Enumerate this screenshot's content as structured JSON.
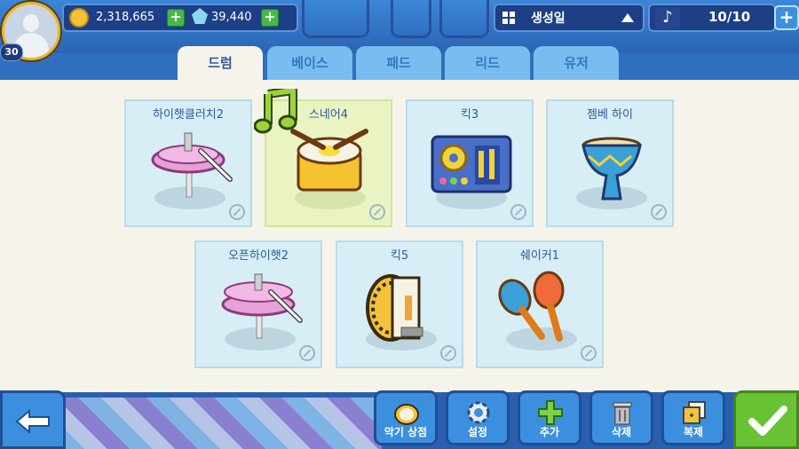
{
  "player": {
    "level": "30"
  },
  "currency": {
    "coins": "2,318,665",
    "gems": "39,440"
  },
  "sort": {
    "label": "생성일"
  },
  "notes": {
    "count": "10/10"
  },
  "tabs": [
    {
      "label": "드럼",
      "active": true
    },
    {
      "label": "베이스",
      "active": false
    },
    {
      "label": "패드",
      "active": false
    },
    {
      "label": "리드",
      "active": false
    },
    {
      "label": "유저",
      "active": false
    }
  ],
  "instruments": [
    {
      "name": "하이햇클러치2",
      "icon": "cymbal-icon",
      "selected": false
    },
    {
      "name": "스네어4",
      "icon": "snare-drum-icon",
      "selected": true
    },
    {
      "name": "킥3",
      "icon": "drum-machine-icon",
      "selected": false
    },
    {
      "name": "젬베 하이",
      "icon": "djembe-icon",
      "selected": false
    },
    {
      "name": "오픈하이햇2",
      "icon": "cymbal-icon",
      "selected": false
    },
    {
      "name": "킥5",
      "icon": "kick-drum-icon",
      "selected": false
    },
    {
      "name": "쉐이커1",
      "icon": "maracas-icon",
      "selected": false
    }
  ],
  "toolbar": {
    "shop": "악기 상점",
    "settings": "설정",
    "add": "추가",
    "delete": "삭제",
    "copy": "복제"
  },
  "colors": {
    "accent": "#3c8fdf",
    "confirm": "#69c233",
    "panel": "#f6f4ea"
  }
}
